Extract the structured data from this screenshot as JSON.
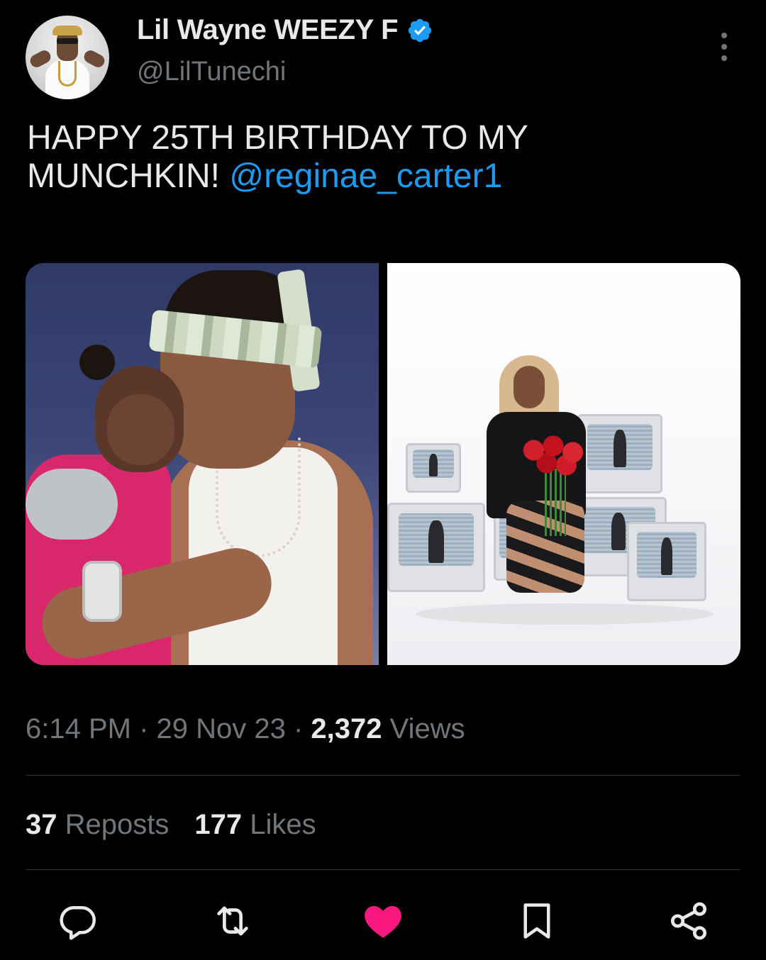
{
  "author": {
    "display_name": "Lil Wayne WEEZY F",
    "handle": "@LilTunechi",
    "verified_icon": "verified-badge-icon"
  },
  "tweet": {
    "text_line1": "HAPPY 25TH BIRTHDAY TO MY",
    "text_line2": "MUNCHKIN!",
    "mention": "@reginae_carter1"
  },
  "media": [
    {
      "name": "photo-father-and-baby"
    },
    {
      "name": "photo-woman-with-roses-and-tvs"
    }
  ],
  "meta": {
    "time": "6:14 PM",
    "sep1": " · ",
    "date": "29 Nov 23",
    "sep2": " · ",
    "views_count": "2,372",
    "views_label": " Views"
  },
  "stats": {
    "reposts_count": "37",
    "reposts_label": " Reposts",
    "likes_count": "177",
    "likes_label": " Likes"
  },
  "actions": [
    "reply-icon",
    "repost-icon",
    "like-icon",
    "bookmark-icon",
    "share-icon"
  ],
  "colors": {
    "background": "#000000",
    "text_primary": "#e7e9ea",
    "text_secondary": "#71767b",
    "link": "#1d9bf0",
    "like_active": "#f91880",
    "divider": "#2f3336"
  }
}
